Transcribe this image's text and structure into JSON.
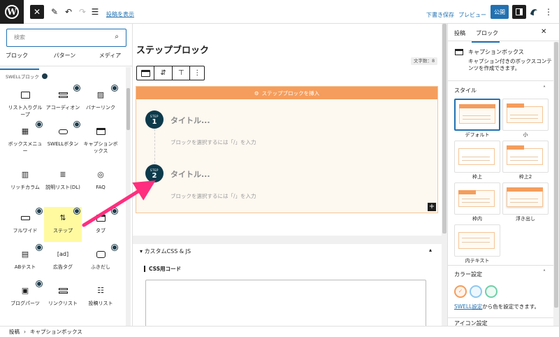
{
  "toolbar": {
    "show_post_label": "投稿を表示",
    "draft_label": "下書き保存",
    "preview_label": "プレビュー",
    "publish_label": "公開"
  },
  "inserter": {
    "search_placeholder": "検索",
    "tabs": [
      "ブロック",
      "パターン",
      "メディア"
    ],
    "category_label": "SWELLブロック",
    "blocks": [
      {
        "label": "リスト入りグループ",
        "icon": "list-group-icon"
      },
      {
        "label": "アコーディオン",
        "icon": "accordion-icon"
      },
      {
        "label": "バナーリンク",
        "icon": "banner-link-icon"
      },
      {
        "label": "ボックスメニュー",
        "icon": "box-menu-icon"
      },
      {
        "label": "SWELLボタン",
        "icon": "button-icon"
      },
      {
        "label": "キャプションボックス",
        "icon": "caption-box-icon"
      },
      {
        "label": "リッチカラム",
        "icon": "rich-column-icon"
      },
      {
        "label": "説明リスト(DL)",
        "icon": "description-list-icon"
      },
      {
        "label": "FAQ",
        "icon": "faq-icon"
      },
      {
        "label": "フルワイド",
        "icon": "full-wide-icon"
      },
      {
        "label": "ステップ",
        "icon": "step-icon"
      },
      {
        "label": "タブ",
        "icon": "tab-icon"
      },
      {
        "label": "ABテスト",
        "icon": "ab-test-icon"
      },
      {
        "label": "広告タグ",
        "icon": "ad-tag-icon"
      },
      {
        "label": "ふきだし",
        "icon": "speech-bubble-icon"
      },
      {
        "label": "ブログパーツ",
        "icon": "blog-parts-icon"
      },
      {
        "label": "リンクリスト",
        "icon": "link-list-icon"
      },
      {
        "label": "投稿リスト",
        "icon": "post-list-icon"
      }
    ]
  },
  "editor": {
    "title": "ステップブロック",
    "char_count": "文字数：8",
    "insert_label": "ステップブロックを挿入",
    "steps": [
      {
        "step_label": "STEP",
        "number": "1",
        "title": "タイトル...",
        "hint": "ブロックを選択するには「/」を入力"
      },
      {
        "step_label": "STEP",
        "number": "2",
        "title": "タイトル...",
        "hint": "ブロックを選択するには「/」を入力"
      }
    ],
    "meta_title": "カスタムCSS & JS",
    "meta_subtitle": "CSS用コード"
  },
  "sidebar": {
    "tabs": [
      "投稿",
      "ブロック"
    ],
    "block_name": "キャプションボックス",
    "block_desc": "キャプション付きのボックスコンテンツを作成できます。",
    "style_section": "スタイル",
    "styles": [
      {
        "label": "デフォルト",
        "head_text": "Pop Title"
      },
      {
        "label": "小",
        "head_text": "Pop Title"
      },
      {
        "label": "枠上",
        "head_text": "Pop Title"
      },
      {
        "label": "枠上2",
        "head_text": "Pop Title"
      },
      {
        "label": "枠内",
        "head_text": "Pop Title"
      },
      {
        "label": "浮き出し",
        "head_text": "Pop Title"
      },
      {
        "label": "内テキスト",
        "head_text": "Pop Title"
      }
    ],
    "color_section": "カラー設定",
    "color_note_link": "SWELL設定",
    "color_note_text": "から色を設定できます。",
    "icon_section": "アイコン設定",
    "colors": [
      "#f59d5c",
      "#8ec8f0",
      "#6fd0a8"
    ]
  },
  "breadcrumb": [
    "投稿",
    "キャプションボックス"
  ]
}
